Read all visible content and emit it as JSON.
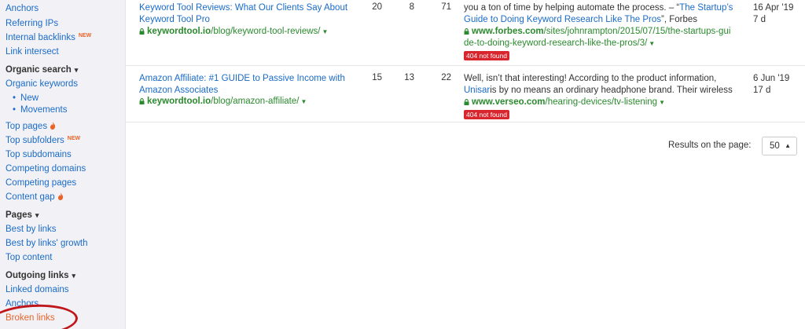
{
  "sidebar": {
    "anchors_top": "Anchors",
    "referring_ips": "Referring IPs",
    "internal_backlinks": "Internal backlinks",
    "new_badge": "NEW",
    "link_intersect": "Link intersect",
    "organic_search": "Organic search",
    "organic_keywords": "Organic keywords",
    "new": "New",
    "movements": "Movements",
    "top_pages": "Top pages",
    "top_subfolders": "Top subfolders",
    "top_subdomains": "Top subdomains",
    "competing_domains": "Competing domains",
    "competing_pages": "Competing pages",
    "content_gap": "Content gap",
    "pages": "Pages",
    "best_by_links": "Best by links",
    "best_by_links_growth": "Best by links' growth",
    "top_content": "Top content",
    "outgoing_links": "Outgoing links",
    "linked_domains": "Linked domains",
    "anchors_bottom": "Anchors",
    "broken_links": "Broken links"
  },
  "rows": [
    {
      "title_line1": "Keyword Tool Reviews: What Our Clients Say About",
      "title_line2": "Keyword Tool Pro",
      "url_domain": "keywordtool.io",
      "url_path": "/blog/keyword-tool-reviews/",
      "n1": "20",
      "n2": "8",
      "n3": "71",
      "ctx_line1": "you a ton of time by helping automate the process. – “",
      "ctx_link1": "The Startup’s",
      "ctx_link2": "Guide to Doing Keyword Research Like The Pros",
      "ctx_tail": "”, Forbes",
      "target_domain": "www.forbes.com",
      "target_path1": "/sites/johnrampton/2015/07/15/the-startups-gui",
      "target_path2": "de-to-doing-keyword-research-like-the-pros/3/",
      "badge": "404 not found",
      "date": "16 Apr '19",
      "age": "7 d"
    },
    {
      "title_line1": "Amazon Affiliate: #1 GUIDE to Passive Income with",
      "title_line2": "Amazon Associates",
      "url_domain": "keywordtool.io",
      "url_path": "/blog/amazon-affiliate/",
      "n1": "15",
      "n2": "13",
      "n3": "22",
      "ctx_line1": "Well, isn’t that interesting! According to the product information,",
      "ctx_link": "Unisar",
      "ctx_rest": "is by no means an ordinary headphone brand. Their wireless",
      "target_domain": "www.verseo.com",
      "target_path": "/hearing-devices/tv-listening",
      "badge": "404 not found",
      "date": "6 Jun '19",
      "age": "17 d"
    }
  ],
  "pager": {
    "label": "Results on the page:",
    "value": "50"
  },
  "colors": {
    "link": "#1a6bc8",
    "url_green": "#2b8a2e",
    "badge_red": "#d9262e",
    "accent_orange": "#e8642a",
    "annotation_circle": "#c0171c"
  }
}
